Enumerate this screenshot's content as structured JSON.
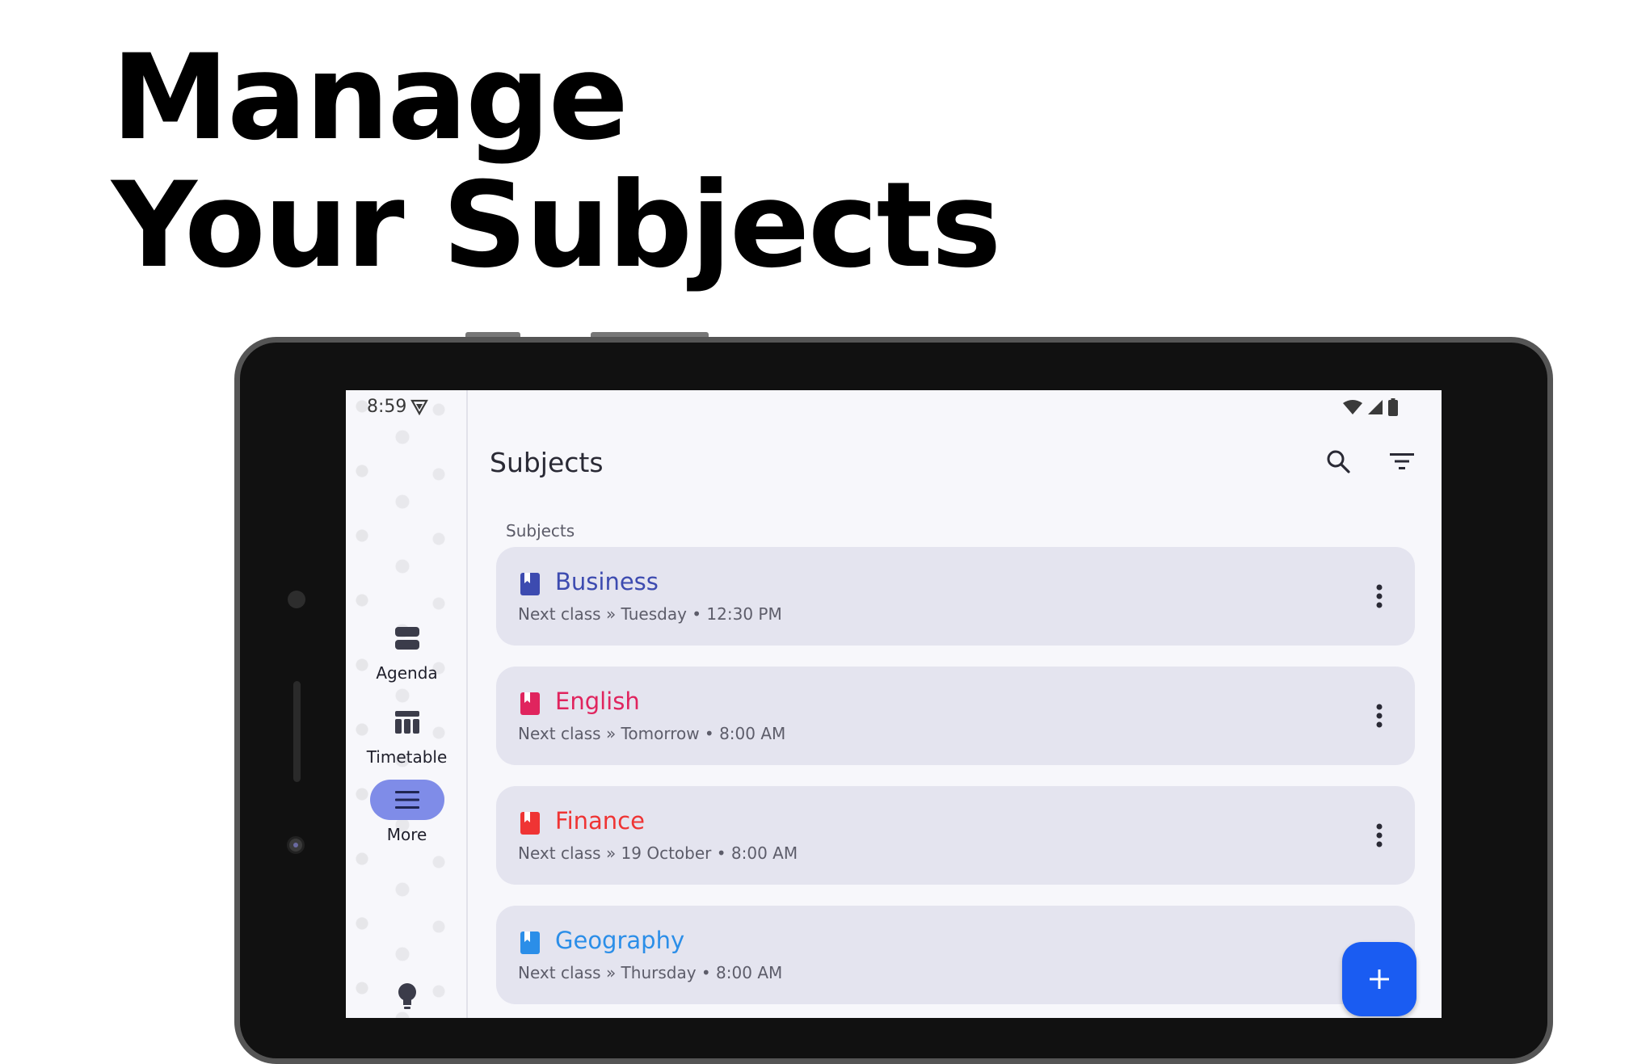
{
  "headline": {
    "line1": "Manage",
    "line2": "Your Subjects"
  },
  "status_bar": {
    "time": "8:59"
  },
  "rail": {
    "items": [
      {
        "label": "Agenda",
        "icon": "agenda-icon",
        "active": false
      },
      {
        "label": "Timetable",
        "icon": "timetable-icon",
        "active": false
      },
      {
        "label": "More",
        "icon": "menu-icon",
        "active": true
      }
    ],
    "bottom_icon": "lightbulb-icon"
  },
  "app_bar": {
    "title": "Subjects",
    "search_icon": "search-icon",
    "filter_icon": "filter-icon"
  },
  "section_label": "Subjects",
  "subjects": [
    {
      "name": "Business",
      "next": "Next class » Tuesday • 12:30 PM",
      "color": "#3d4bb0"
    },
    {
      "name": "English",
      "next": "Next class » Tomorrow • 8:00 AM",
      "color": "#e0245e"
    },
    {
      "name": "Finance",
      "next": "Next class » 19 October • 8:00 AM",
      "color": "#ef3434"
    },
    {
      "name": "Geography",
      "next": "Next class » Thursday • 8:00 AM",
      "color": "#2b8ee8"
    }
  ],
  "fab": {
    "icon": "plus-icon",
    "color": "#1a5cf2"
  }
}
